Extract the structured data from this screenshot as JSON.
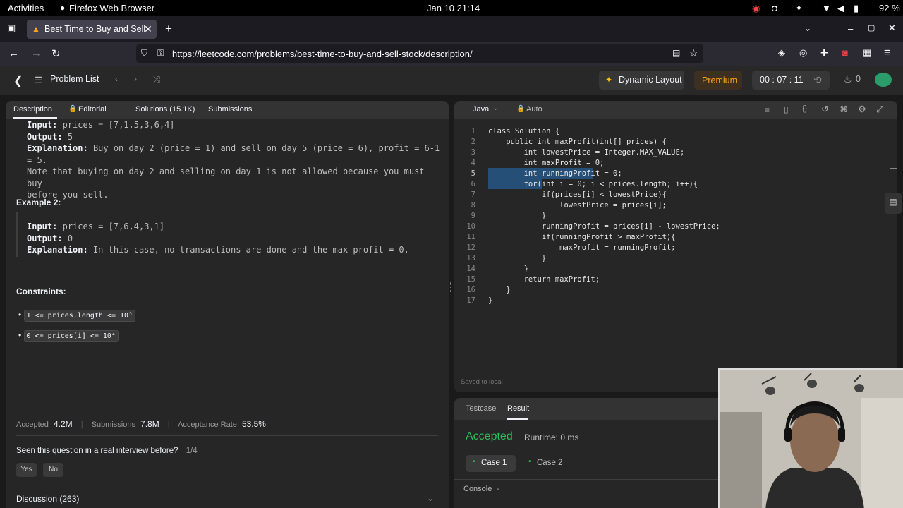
{
  "system": {
    "activities": "Activities",
    "app_name": "Firefox Web Browser",
    "datetime": "Jan 10  21:14",
    "battery": "92 %"
  },
  "browser": {
    "tab_title": "Best Time to Buy and Sell",
    "url": "https://leetcode.com/problems/best-time-to-buy-and-sell-stock/description/"
  },
  "leetcode": {
    "problem_list": "Problem List",
    "dynamic_layout": "Dynamic Layout",
    "premium": "Premium",
    "timer": "00 : 07 : 11",
    "streak": "0"
  },
  "left_tabs": {
    "description": "Description",
    "editorial": "Editorial",
    "solutions": "Solutions (15.1K)",
    "submissions": "Submissions"
  },
  "example1": {
    "input_label": "Input:",
    "input_value": "prices = [7,1,5,3,6,4]",
    "output_label": "Output:",
    "output_value": "5",
    "explanation_label": "Explanation:",
    "explanation_value": "Buy on day 2 (price = 1) and sell on day 5 (price = 6), profit = 6-1",
    "explanation_cont": "= 5.",
    "note1": "Note that buying on day 2 and selling on day 1 is not allowed because you must buy",
    "note2": "before you sell."
  },
  "example2": {
    "heading": "Example 2:",
    "input_label": "Input:",
    "input_value": "prices = [7,6,4,3,1]",
    "output_label": "Output:",
    "output_value": "0",
    "explanation_label": "Explanation:",
    "explanation_value": "In this case, no transactions are done and the max profit = 0."
  },
  "constraints": {
    "heading": "Constraints:",
    "c1": "1 <= prices.length <= 10⁵",
    "c2": "0 <= prices[i] <= 10⁴"
  },
  "stats": {
    "accepted_label": "Accepted",
    "accepted_value": "4.2M",
    "submissions_label": "Submissions",
    "submissions_value": "7.8M",
    "rate_label": "Acceptance Rate",
    "rate_value": "53.5%"
  },
  "interview": {
    "question": "Seen this question in a real interview before?",
    "count": "1/4",
    "yes": "Yes",
    "no": "No"
  },
  "discussion": "Discussion (263)",
  "editor": {
    "language": "Java",
    "auto": "Auto",
    "saved": "Saved to local",
    "lines": [
      "class Solution {",
      "    public int maxProfit(int[] prices) {",
      "        int lowestPrice = Integer.MAX_VALUE;",
      "        int maxProfit = 0;",
      "        int runningProfit = 0;",
      "        for(int i = 0; i < prices.length; i++){",
      "            if(prices[i] < lowestPrice){",
      "                lowestPrice = prices[i];",
      "            }",
      "            runningProfit = prices[i] - lowestPrice;",
      "            if(runningProfit > maxProfit){",
      "                maxProfit = runningProfit;",
      "            }",
      "        }",
      "        return maxProfit;",
      "    }",
      "}"
    ]
  },
  "result": {
    "testcase_tab": "Testcase",
    "result_tab": "Result",
    "status": "Accepted",
    "runtime": "Runtime: 0 ms",
    "case1": "Case 1",
    "case2": "Case 2",
    "console": "Console"
  },
  "colors": {
    "accepted": "#2cbb5d",
    "premium": "#ffa116",
    "bg": "#1a1a1a",
    "panel": "#262626"
  }
}
